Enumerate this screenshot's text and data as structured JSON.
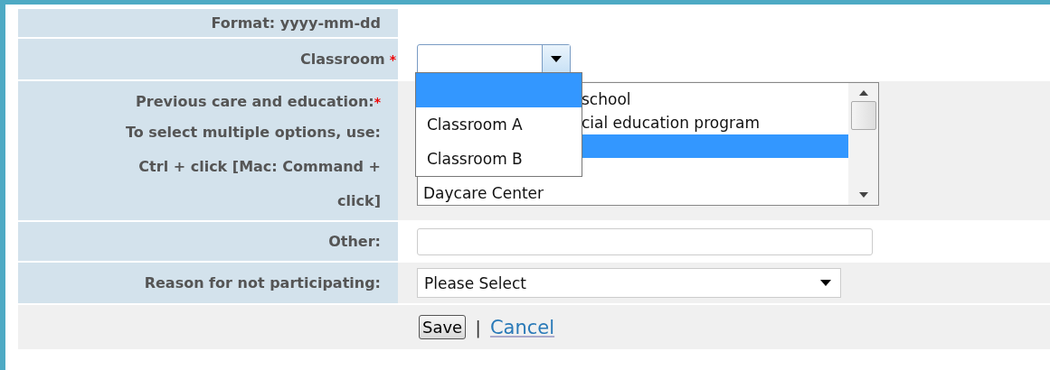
{
  "fields": [
    {
      "kind": "note",
      "label": "Format: yyyy-mm-dd"
    },
    {
      "kind": "dropdown",
      "label": "Classroom",
      "required_mark": "*",
      "open": true,
      "options": [
        {
          "selected": true
        },
        {
          "text": "Classroom A",
          "selected": false
        },
        {
          "text": "Classroom B",
          "selected": false
        }
      ]
    },
    {
      "kind": "multiselect",
      "label": "Previous care and education:",
      "required_mark": "*",
      "help": "To select multiple options, use: Ctrl + click [Mac: Command + click]",
      "options": [
        {
          "kind": "partial",
          "text": "school",
          "selected": false
        },
        {
          "kind": "partial",
          "text": "cial education program",
          "selected": false
        },
        {
          "kind": "hidden",
          "selected": true
        },
        {
          "kind": "hidden",
          "selected": false
        },
        {
          "kind": "full",
          "text": "Daycare Center",
          "selected": false
        }
      ]
    },
    {
      "kind": "text",
      "label": "Other:"
    },
    {
      "kind": "select",
      "label": "Reason for not participating:",
      "value": "Please Select"
    }
  ],
  "actions": {
    "save": "Save",
    "separator": "|",
    "cancel": "Cancel"
  }
}
